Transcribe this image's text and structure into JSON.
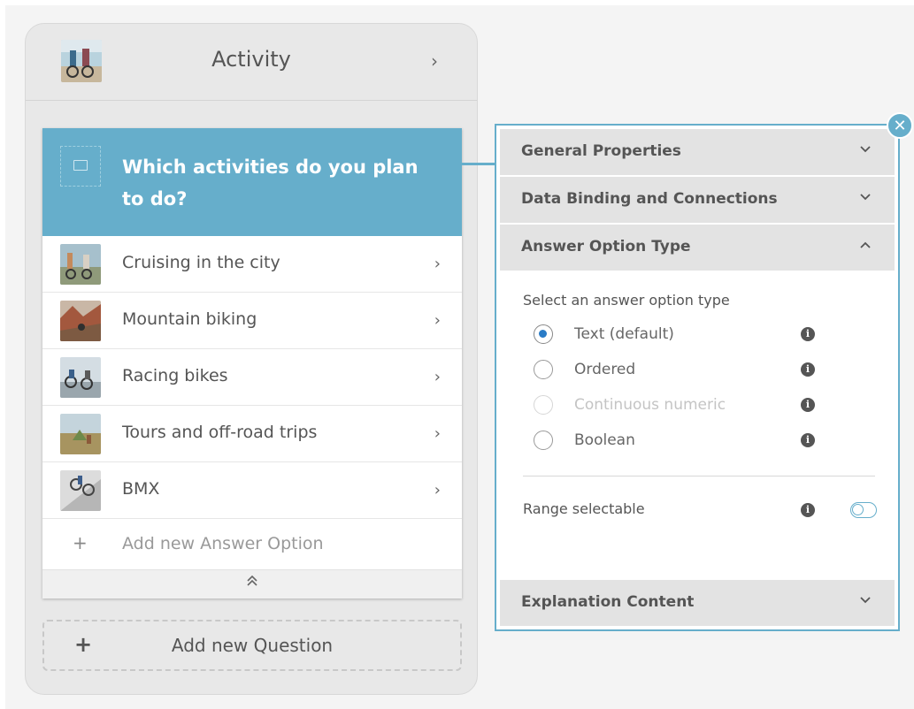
{
  "activity": {
    "title": "Activity",
    "chevron": "›"
  },
  "question": {
    "text": "Which activities do you plan to do?",
    "image_placeholder_icon": "image-icon",
    "answers": [
      {
        "label": "Cruising in the city"
      },
      {
        "label": "Mountain biking"
      },
      {
        "label": "Racing bikes"
      },
      {
        "label": "Tours and off-road trips"
      },
      {
        "label": "BMX"
      }
    ],
    "add_answer_label": "Add new Answer Option",
    "add_answer_plus": "+",
    "collapse_icon": "⌃"
  },
  "add_question": {
    "plus": "+",
    "label": "Add new Question"
  },
  "panel": {
    "close_glyph": "✕",
    "sections": {
      "general": "General Properties",
      "data_binding": "Data Binding and Connections",
      "answer_option_type": "Answer Option Type",
      "explanation": "Explanation Content"
    },
    "caret_down": "⌄",
    "caret_up": "⌃",
    "select_label": "Select an answer option type",
    "options": [
      {
        "label": "Text (default)",
        "checked": true,
        "disabled": false
      },
      {
        "label": "Ordered",
        "checked": false,
        "disabled": false
      },
      {
        "label": "Continuous numeric",
        "checked": false,
        "disabled": true
      },
      {
        "label": "Boolean",
        "checked": false,
        "disabled": false
      }
    ],
    "info_glyph": "i",
    "range_label": "Range selectable",
    "range_on": false
  },
  "colors": {
    "accent": "#66aecb",
    "radio_selected": "#2a7cc7"
  }
}
